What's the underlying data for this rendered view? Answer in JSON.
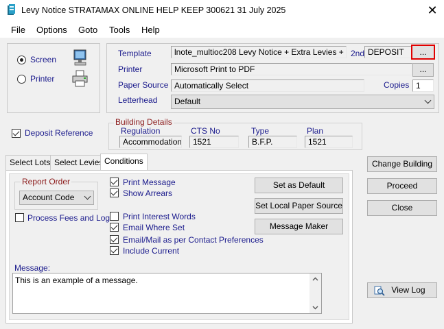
{
  "window": {
    "title": "Levy Notice STRATAMAX ONLINE HELP KEEP 300621 31 July 2025",
    "close_glyph": "✕"
  },
  "menu": [
    "File",
    "Options",
    "Goto",
    "Tools",
    "Help"
  ],
  "output": {
    "screen_label": "Screen",
    "printer_label": "Printer",
    "selected": "Screen"
  },
  "template": {
    "label": "Template",
    "value": "lnote_multioc208 Levy Notice + Extra Levies +",
    "second_label": "2nd",
    "second_value": "DEPOSIT",
    "browse_label": "..."
  },
  "printer": {
    "label": "Printer",
    "value": "Microsoft Print to PDF",
    "browse_label": "..."
  },
  "paper_source": {
    "label": "Paper Source",
    "value": "Automatically Select",
    "copies_label": "Copies",
    "copies_value": "1"
  },
  "letterhead": {
    "label": "Letterhead",
    "value": "Default"
  },
  "deposit_reference": {
    "label": "Deposit Reference",
    "checked": true
  },
  "building_details": {
    "group_label": "Building Details",
    "regulation_label": "Regulation",
    "regulation_value": "Accommodation",
    "cts_label": "CTS No",
    "cts_value": "1521",
    "type_label": "Type",
    "type_value": "B.F.P.",
    "plan_label": "Plan",
    "plan_value": "1521"
  },
  "tabs": [
    "Select Lots",
    "Select Levies",
    "Conditions"
  ],
  "active_tab": "Conditions",
  "conditions": {
    "report_order_label": "Report Order",
    "report_order_value": "Account Code",
    "process_fees_label": "Process Fees and Log",
    "checks": [
      {
        "label": "Print Message",
        "checked": true
      },
      {
        "label": "Show Arrears",
        "checked": true
      },
      {
        "label": "Print Interest Words",
        "checked": false
      },
      {
        "label": "Email Where Set",
        "checked": true
      },
      {
        "label": "Email/Mail as per Contact Preferences",
        "checked": true
      },
      {
        "label": "Include Current",
        "checked": true
      }
    ],
    "set_default_label": "Set as Default",
    "set_paper_label": "Set Local Paper Source",
    "message_maker_label": "Message Maker",
    "message_label": "Message:",
    "message_value": "This is an example of a message."
  },
  "side_buttons": {
    "change_building": "Change Building",
    "proceed": "Proceed",
    "close": "Close",
    "view_log": "View Log"
  },
  "colors": {
    "label_blue": "#1a1a8c",
    "label_red": "#8b1a1a",
    "highlight": "#e00000"
  }
}
